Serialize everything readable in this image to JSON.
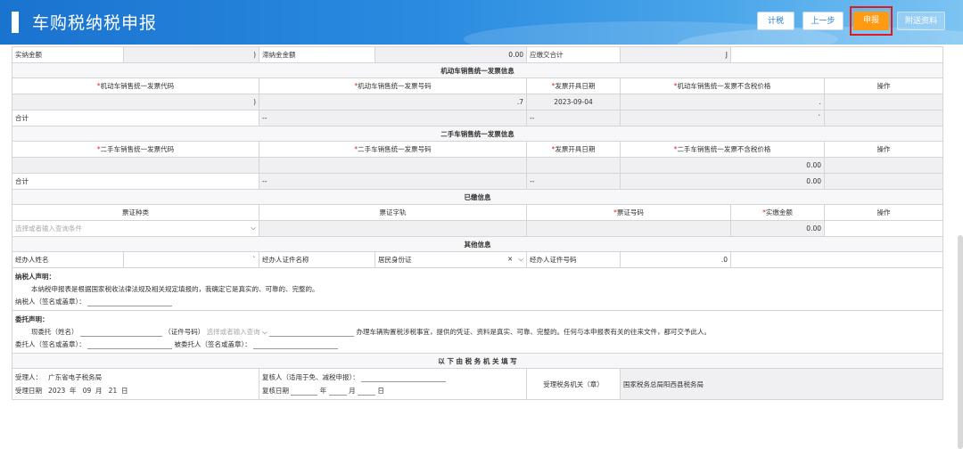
{
  "header": {
    "title": "车购税纳税申报",
    "buttons": {
      "calc": "计税",
      "prev": "上一步",
      "submit": "申报",
      "attach": "附送资料"
    }
  },
  "summary": {
    "actual_tax_label": "实纳金额",
    "actual_tax_value": "",
    "late_fee_label": "滞纳金金额",
    "late_fee_value": "0.00",
    "total_label": "应缴交合计",
    "total_value": "J"
  },
  "motor_invoice": {
    "section_title": "机动车销售统一发票信息",
    "columns": [
      "机动车销售统一发票代码",
      "机动车销售统一发票号码",
      "发票开具日期",
      "机动车销售统一发票不含税价格",
      "操作"
    ],
    "row": {
      "code": ")",
      "number": ".7",
      "date": "2023-09-04",
      "price": ".",
      "op": ""
    },
    "total_label": "合计",
    "total_number": "--",
    "total_date": "--",
    "total_price": "`"
  },
  "used_invoice": {
    "section_title": "二手车销售统一发票信息",
    "columns": [
      "二手车销售统一发票代码",
      "二手车销售统一发票号码",
      "发票开具日期",
      "二手车销售统一发票不含税价格",
      "操作"
    ],
    "row_price": "0.00",
    "total_label": "合计",
    "total_number": "--",
    "total_date": "--",
    "total_price": "0.00"
  },
  "paid": {
    "section_title": "已缴信息",
    "columns": [
      "票证种类",
      "票证字轨",
      "票证号码",
      "实缴金额",
      "操作"
    ],
    "type_placeholder": "选择或者输入查询条件",
    "amount": "0.00"
  },
  "other": {
    "section_title": "其他信息",
    "agent_name_label": "经办人姓名",
    "agent_name_value": "`",
    "cert_name_label": "经办人证件名称",
    "cert_name_value": "居民身份证",
    "cert_no_label": "经办人证件号码",
    "cert_no_value": ".0"
  },
  "declaration": {
    "title": "纳税人声明：",
    "text": "本纳税申报表是根据国家税收法律法规及相关规定填报的，我确定它是真实的、可靠的、完整的。",
    "sign_label": "纳税人（签名或盖章）："
  },
  "entrust": {
    "title": "委托声明：",
    "now_label": "现委托（姓名）",
    "cert_label": "（证件号码）",
    "cert_placeholder": "选择或者输入查询",
    "text": "办理车辆购置税涉税事宜，提供的凭证、资料是真实、可靠、完整的。任何与本申报表有关的往来文件，都可交予此人。",
    "principal_label": "委托人（签名或盖章）：",
    "agent_label": "被委托人（签名或盖章）："
  },
  "office": {
    "section_title": "以 下 由 税 务 机 关 填 写",
    "receiver_label": "受理人：",
    "receiver_value": "广东省电子税务局",
    "date_label": "受理日期",
    "year": "2023",
    "month": "09",
    "day": "21",
    "year_unit": "年",
    "month_unit": "月",
    "day_unit": "日",
    "reviewer_label": "复核人（适用于免、减税申报）：",
    "review_date_label": "复核日期",
    "office_label": "受理税务机关（章）",
    "office_value": "国家税务总局阳西县税务局"
  }
}
